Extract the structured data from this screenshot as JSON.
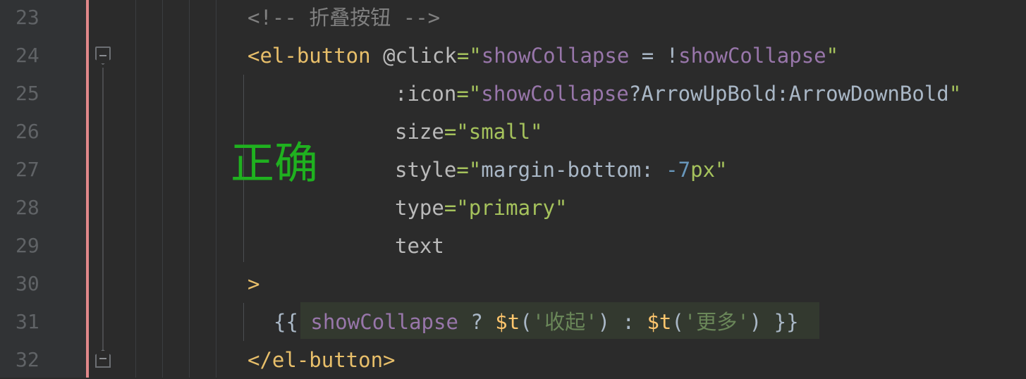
{
  "editor": {
    "annotation": "正确",
    "lines": [
      {
        "number": "23",
        "tokens": [
          [
            "c-comment",
            "<!-- 折叠按钮 -->"
          ]
        ]
      },
      {
        "number": "24",
        "tokens": [
          [
            "c-tag",
            "<el-button"
          ],
          [
            "c-plain",
            " "
          ],
          [
            "c-attr",
            "@click"
          ],
          [
            "c-str",
            "=\""
          ],
          [
            "c-var",
            "showCollapse"
          ],
          [
            "c-plain",
            " = !"
          ],
          [
            "c-var",
            "showCollapse"
          ],
          [
            "c-str",
            "\""
          ]
        ]
      },
      {
        "number": "25",
        "tokens": [
          [
            "c-attr",
            ":icon"
          ],
          [
            "c-str",
            "=\""
          ],
          [
            "c-var",
            "showCollapse"
          ],
          [
            "c-plain",
            "?ArrowUpBold:ArrowDownBold"
          ],
          [
            "c-str",
            "\""
          ]
        ]
      },
      {
        "number": "26",
        "tokens": [
          [
            "c-attr",
            "size"
          ],
          [
            "c-str",
            "=\"small\""
          ]
        ]
      },
      {
        "number": "27",
        "tokens": [
          [
            "c-attr",
            "style"
          ],
          [
            "c-str",
            "=\""
          ],
          [
            "c-plain",
            "margin-bottom: "
          ],
          [
            "c-num",
            "-7"
          ],
          [
            "c-str",
            "px\""
          ]
        ]
      },
      {
        "number": "28",
        "tokens": [
          [
            "c-attr",
            "type"
          ],
          [
            "c-str",
            "=\"primary\""
          ]
        ]
      },
      {
        "number": "29",
        "tokens": [
          [
            "c-attr",
            "text"
          ]
        ]
      },
      {
        "number": "30",
        "tokens": [
          [
            "c-tag",
            ">"
          ]
        ]
      },
      {
        "number": "31",
        "tokens": [
          [
            "c-plain",
            "{{ "
          ],
          [
            "c-var",
            "showCollapse"
          ],
          [
            "c-plain",
            " ? "
          ],
          [
            "c-fn",
            "$t"
          ],
          [
            "c-plain",
            "("
          ],
          [
            "c-cstr",
            "'收起'"
          ],
          [
            "c-plain",
            ") : "
          ],
          [
            "c-fn",
            "$t"
          ],
          [
            "c-plain",
            "("
          ],
          [
            "c-cstr",
            "'更多'"
          ],
          [
            "c-plain",
            ") }}"
          ]
        ]
      },
      {
        "number": "32",
        "tokens": [
          [
            "c-tag",
            "</el-button>"
          ]
        ]
      }
    ]
  },
  "colors": {
    "background": "#2b2b2b",
    "gutter": "#313335",
    "change_marker": "#e0888a",
    "annotation": "#1fb11f"
  }
}
